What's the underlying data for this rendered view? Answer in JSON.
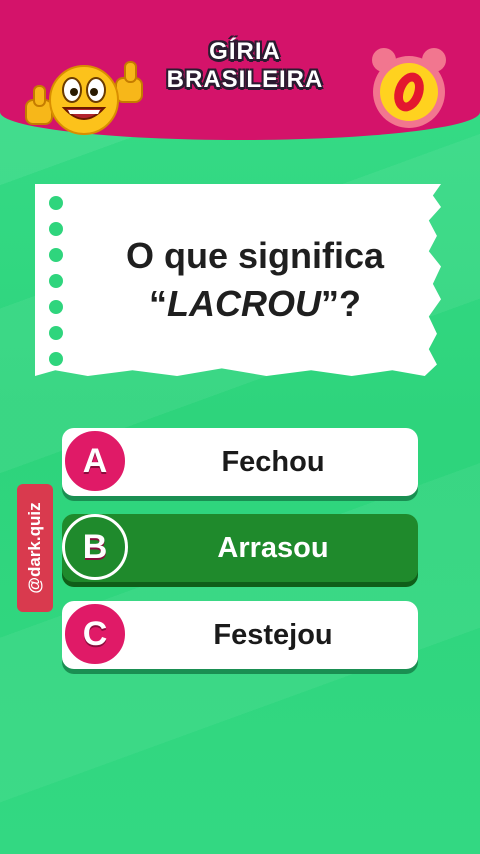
{
  "header": {
    "title_line1": "GÍRIA",
    "title_line2": "BRASILEIRA",
    "background_color": "#d4136a",
    "emoji_icon": "thumbs-up-smiley-icon",
    "timer_icon": "alarm-clock-icon",
    "timer_value": "0"
  },
  "question": {
    "prefix": "O que significa",
    "open_quote": "“",
    "term": "LACROU",
    "close_quote": "”?"
  },
  "answers": [
    {
      "letter": "A",
      "text": "Fechou",
      "correct": false
    },
    {
      "letter": "B",
      "text": "Arrasou",
      "correct": true
    },
    {
      "letter": "C",
      "text": "Festejou",
      "correct": false
    }
  ],
  "handle": "@dark.quiz",
  "colors": {
    "background": "#2fd57d",
    "letter_badge": "#e01a67",
    "correct": "#1f8a2c"
  }
}
